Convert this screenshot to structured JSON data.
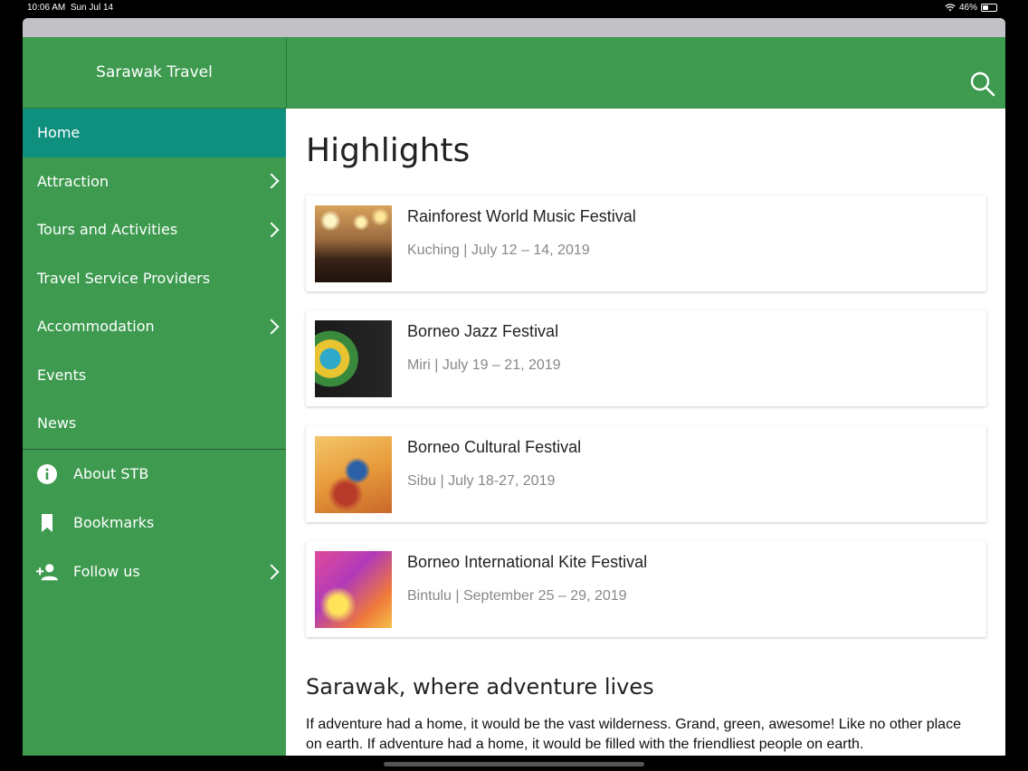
{
  "status": {
    "time": "10:06 AM",
    "date": "Sun Jul 14",
    "battery": "46%",
    "battery_level": 0.46
  },
  "sidebar": {
    "title": "Sarawak Travel",
    "items": [
      {
        "label": "Home",
        "active": true,
        "has_chevron": false
      },
      {
        "label": "Attraction",
        "has_chevron": true
      },
      {
        "label": "Tours and Activities",
        "has_chevron": true
      },
      {
        "label": "Travel Service Providers",
        "has_chevron": false
      },
      {
        "label": "Accommodation",
        "has_chevron": true
      },
      {
        "label": "Events",
        "has_chevron": false
      },
      {
        "label": "News",
        "has_chevron": false
      }
    ],
    "secondary": [
      {
        "label": "About STB",
        "icon": "info-icon"
      },
      {
        "label": "Bookmarks",
        "icon": "bookmark-icon"
      },
      {
        "label": "Follow us",
        "icon": "person-add-icon",
        "has_chevron": true
      }
    ]
  },
  "header": {
    "search_icon": "search-icon"
  },
  "main": {
    "title": "Highlights",
    "events": [
      {
        "title": "Rainforest World Music Festival",
        "subtitle": "Kuching | July 12 – 14, 2019"
      },
      {
        "title": "Borneo Jazz Festival",
        "subtitle": "Miri | July 19 – 21, 2019"
      },
      {
        "title": "Borneo Cultural Festival",
        "subtitle": "Sibu | July 18-27, 2019"
      },
      {
        "title": "Borneo International Kite Festival",
        "subtitle": "Bintulu | September 25 – 29, 2019"
      }
    ],
    "section_title": "Sarawak, where adventure lives",
    "body": "If adventure had a home, it would be the vast wilderness. Grand, green, awesome! Like no other place on earth. If adventure had a home, it would be filled with the friendliest people on earth."
  },
  "colors": {
    "brand_green": "#3d9a4f",
    "active_teal": "#0f8f7e",
    "topstrip": "#c2c2c6"
  }
}
